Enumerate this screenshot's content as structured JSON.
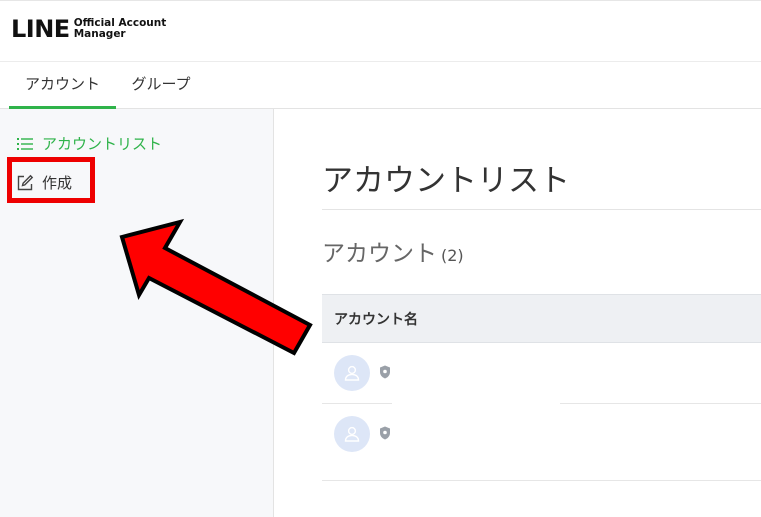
{
  "header": {
    "logo_main": "LINE",
    "logo_sub_1": "Official Account",
    "logo_sub_2": "Manager"
  },
  "tabs": [
    {
      "label": "アカウント",
      "active": true
    },
    {
      "label": "グループ",
      "active": false
    }
  ],
  "sidebar": {
    "items": [
      {
        "label": "アカウントリスト",
        "icon": "list-icon",
        "active": true
      },
      {
        "label": "作成",
        "icon": "edit-icon",
        "active": false
      }
    ]
  },
  "main": {
    "title": "アカウントリスト",
    "section_title": "アカウント",
    "section_count": "(2)",
    "table": {
      "columns": [
        "アカウント名"
      ],
      "rows": [
        {
          "name": "",
          "avatar_icon": "user-icon",
          "badge_icon": "shield-badge-icon"
        },
        {
          "name": "",
          "avatar_icon": "user-icon",
          "badge_icon": "shield-badge-icon"
        }
      ]
    }
  },
  "colors": {
    "brand_green": "#2fb34a",
    "annotation_red": "#ee0000",
    "avatar_bg": "#dde6f7"
  }
}
